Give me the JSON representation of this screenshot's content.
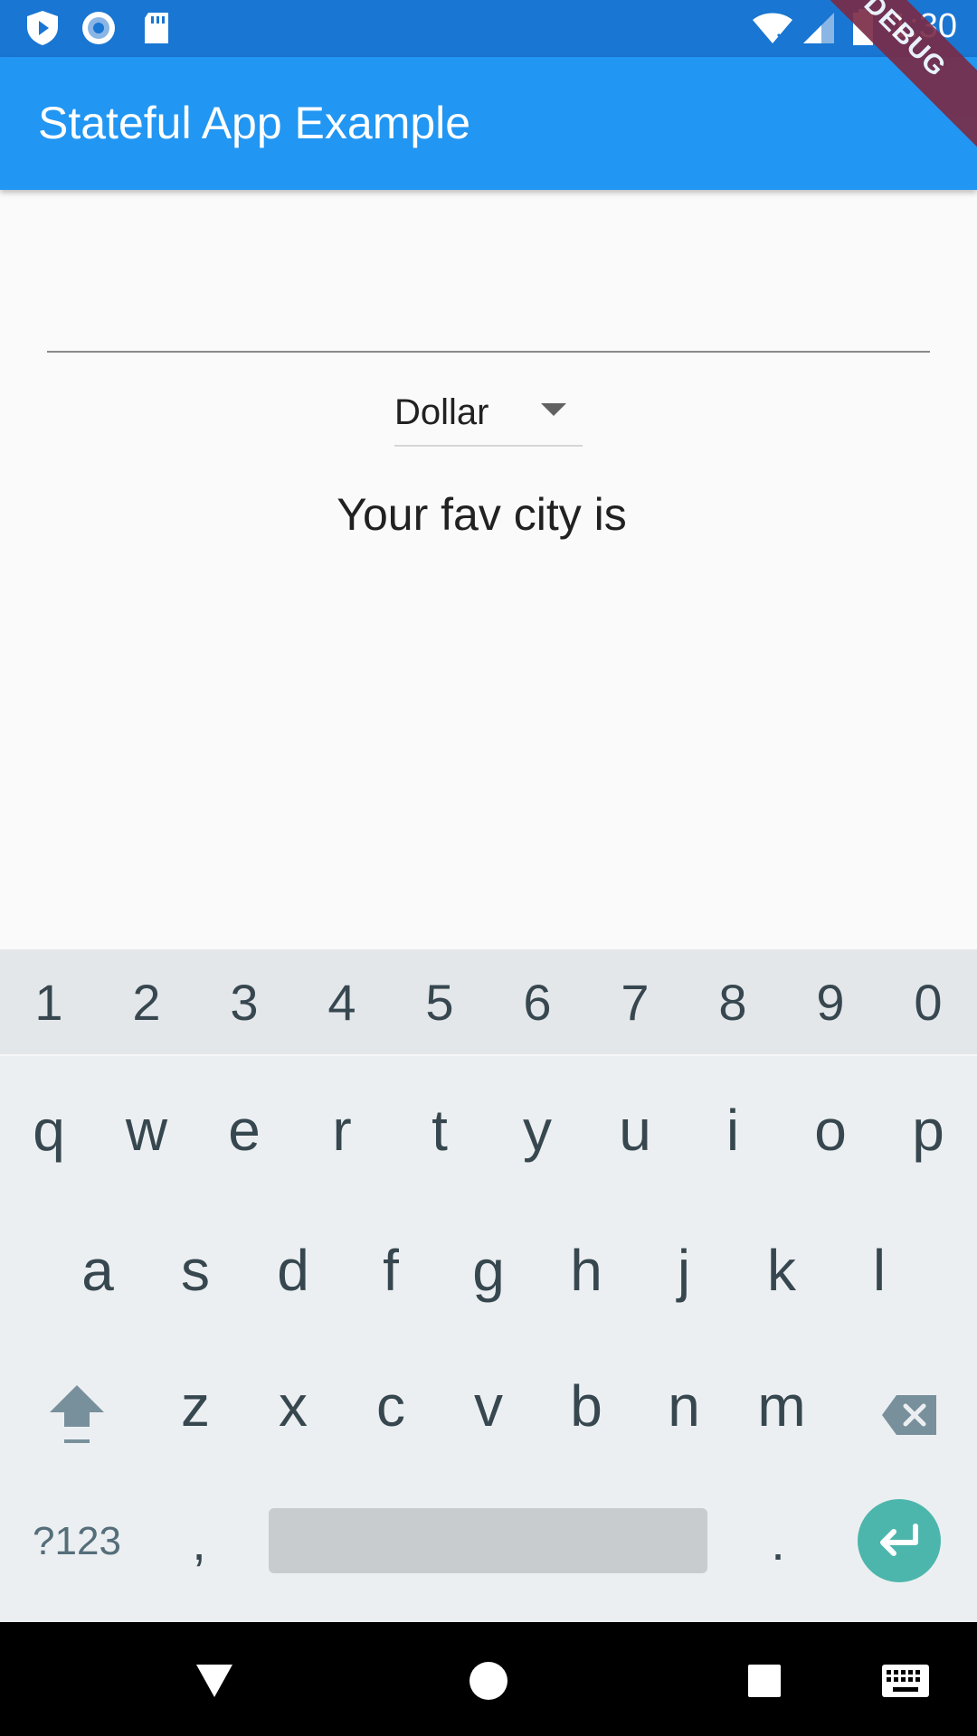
{
  "status_bar": {
    "time": "1:30",
    "icons": [
      "play-protect-icon",
      "record-icon",
      "sd-card-icon",
      "wifi-icon",
      "signal-icon",
      "battery-icon"
    ],
    "color": "#1976d2"
  },
  "app_bar": {
    "title": "Stateful App Example",
    "color": "#2196f3"
  },
  "debug_banner": "DEBUG",
  "text_field": {
    "value": "",
    "placeholder": ""
  },
  "dropdown": {
    "selected": "Dollar"
  },
  "fav_city_text": "Your fav city is",
  "keyboard": {
    "numbers": [
      "1",
      "2",
      "3",
      "4",
      "5",
      "6",
      "7",
      "8",
      "9",
      "0"
    ],
    "row1": [
      "q",
      "w",
      "e",
      "r",
      "t",
      "y",
      "u",
      "i",
      "o",
      "p"
    ],
    "row2": [
      "a",
      "s",
      "d",
      "f",
      "g",
      "h",
      "j",
      "k",
      "l"
    ],
    "row3": [
      "z",
      "x",
      "c",
      "v",
      "b",
      "n",
      "m"
    ],
    "symbols_label": "?123",
    "comma": ",",
    "period": ".",
    "enter_color": "#4db6ac"
  },
  "nav_bar": {
    "buttons": [
      "back-icon",
      "home-icon",
      "recents-icon",
      "keyboard-icon"
    ]
  }
}
